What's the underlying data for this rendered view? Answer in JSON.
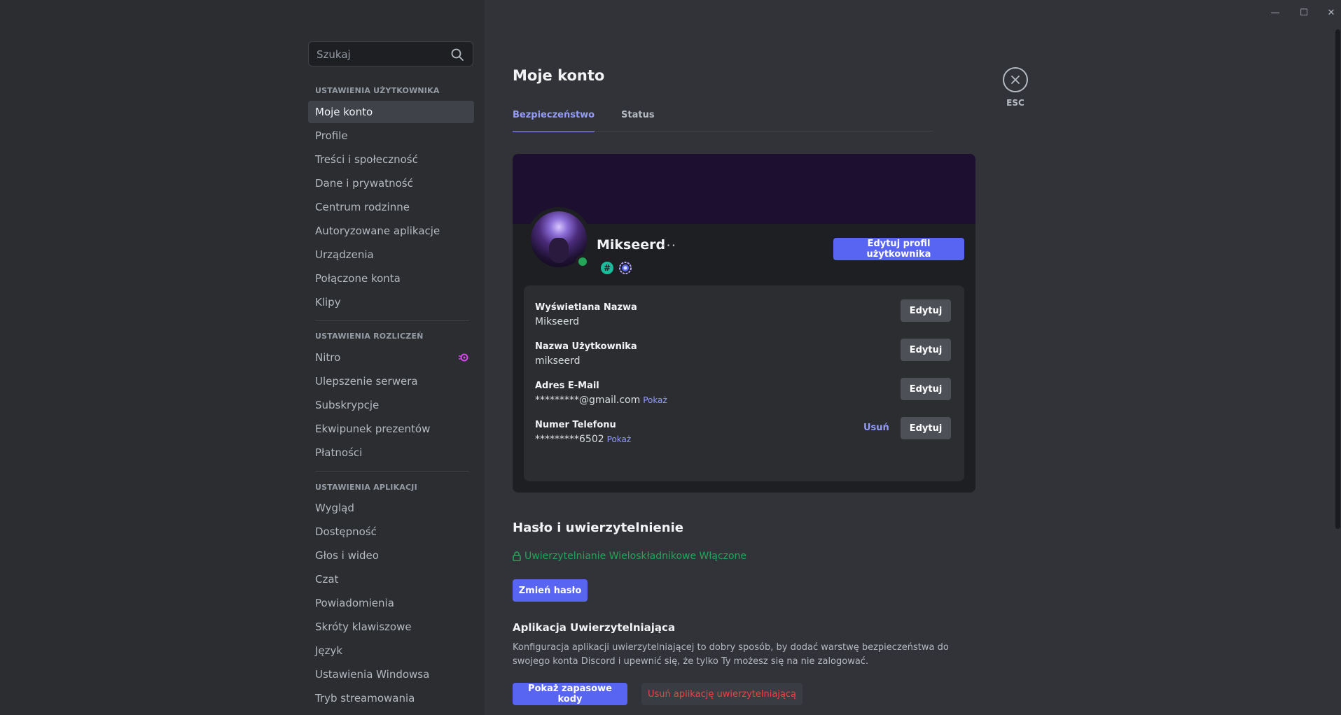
{
  "window": {
    "minimize": "—",
    "maximize": "☐",
    "close": "✕"
  },
  "search": {
    "placeholder": "Szukaj"
  },
  "sidebar": {
    "user_settings_header": "USTAWIENIA UŻYTKOWNIKA",
    "user_items": [
      {
        "label": "Moje konto"
      },
      {
        "label": "Profile"
      },
      {
        "label": "Treści i społeczność"
      },
      {
        "label": "Dane i prywatność"
      },
      {
        "label": "Centrum rodzinne"
      },
      {
        "label": "Autoryzowane aplikacje"
      },
      {
        "label": "Urządzenia"
      },
      {
        "label": "Połączone konta"
      },
      {
        "label": "Klipy"
      }
    ],
    "billing_header": "USTAWIENIA ROZLICZEŃ",
    "billing_items": [
      {
        "label": "Nitro"
      },
      {
        "label": "Ulepszenie serwera"
      },
      {
        "label": "Subskrypcje"
      },
      {
        "label": "Ekwipunek prezentów"
      },
      {
        "label": "Płatności"
      }
    ],
    "app_header": "USTAWIENIA APLIKACJI",
    "app_items": [
      {
        "label": "Wygląd"
      },
      {
        "label": "Dostępność"
      },
      {
        "label": "Głos i wideo"
      },
      {
        "label": "Czat"
      },
      {
        "label": "Powiadomienia"
      },
      {
        "label": "Skróty klawiszowe"
      },
      {
        "label": "Język"
      },
      {
        "label": "Ustawienia Windowsa"
      },
      {
        "label": "Tryb streamowania"
      }
    ],
    "active_item": "Moje konto"
  },
  "main": {
    "title": "Moje konto",
    "tabs": [
      {
        "label": "Bezpieczeństwo",
        "active": true
      },
      {
        "label": "Status",
        "active": false
      }
    ],
    "esc_label": "ESC"
  },
  "profile": {
    "username": "Mikseerd",
    "more": "···",
    "badge_hash": "#",
    "edit_profile_button": "Edytuj profil użytkownika",
    "status": "online",
    "status_color": "#23a55a",
    "fields": [
      {
        "label": "Wyświetlana Nazwa",
        "value": "Mikseerd",
        "edit": "Edytuj"
      },
      {
        "label": "Nazwa Użytkownika",
        "value": "mikseerd",
        "edit": "Edytuj"
      },
      {
        "label": "Adres E-Mail",
        "value": "*********@gmail.com",
        "show": "Pokaż",
        "edit": "Edytuj"
      },
      {
        "label": "Numer Telefonu",
        "value": "*********6502",
        "show": "Pokaż",
        "remove": "Usuń",
        "edit": "Edytuj"
      }
    ]
  },
  "security": {
    "title": "Hasło i uwierzytelnienie",
    "mfa_status": "Uwierzytelnianie Wieloskładnikowe Włączone",
    "change_password_button": "Zmień hasło",
    "auth_app_title": "Aplikacja Uwierzytelniająca",
    "auth_app_desc": "Konfiguracja aplikacji uwierzytelniającej to dobry sposób, by dodać warstwę bezpieczeństwa do swojego konta Discord i upewnić się, że tylko Ty możesz się na nie zalogować.",
    "backup_codes_button": "Pokaż zapasowe kody",
    "remove_auth_button": "Usuń aplikację uwierzytelniającą"
  },
  "colors": {
    "accent": "#5865f2",
    "link": "#949cf7",
    "success": "#23a55a",
    "danger": "#f23f43"
  }
}
